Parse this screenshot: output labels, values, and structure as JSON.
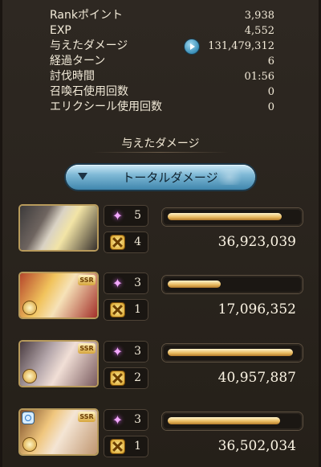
{
  "stats": [
    {
      "label": "Rankポイント",
      "value": "3,938"
    },
    {
      "label": "EXP",
      "value": "4,552"
    },
    {
      "label": "与えたダメージ",
      "value": "131,479,312"
    },
    {
      "label": "経過ターン",
      "value": "6"
    },
    {
      "label": "討伐時間",
      "value": "01:56"
    },
    {
      "label": "召喚石使用回数",
      "value": "0"
    },
    {
      "label": "エリクシール使用回数",
      "value": "0"
    }
  ],
  "section_title": "与えたダメージ",
  "total_button_label": "トータルダメージ",
  "characters": [
    {
      "skill_count": "5",
      "attack_count": "4",
      "damage": "36,923,039",
      "bar_ratio": 0.88
    },
    {
      "skill_count": "3",
      "attack_count": "1",
      "damage": "17,096,352",
      "bar_ratio": 0.41,
      "badge": "SSR"
    },
    {
      "skill_count": "3",
      "attack_count": "2",
      "damage": "40,957,887",
      "bar_ratio": 0.97,
      "badge": "SSR"
    },
    {
      "skill_count": "3",
      "attack_count": "1",
      "damage": "36,502,034",
      "bar_ratio": 0.87,
      "badge": "SSR"
    }
  ]
}
